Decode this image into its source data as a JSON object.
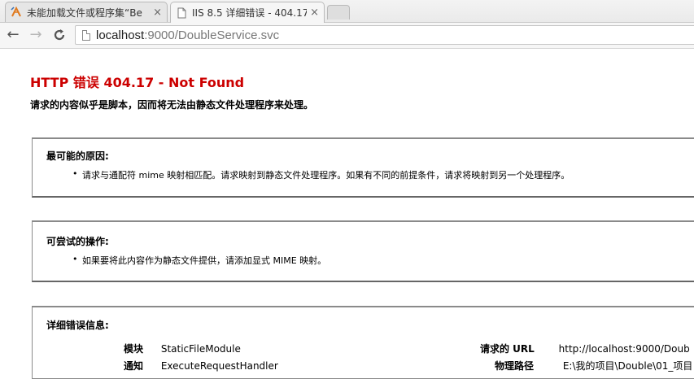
{
  "tabs": [
    {
      "title": "未能加载文件或程序集“Be",
      "active": false,
      "icon": "ie-broken-icon"
    },
    {
      "title": "IIS 8.5 详细错误 - 404.17",
      "active": true,
      "icon": "page-icon"
    }
  ],
  "toolbar": {
    "url_host": "localhost",
    "url_rest": ":9000/DoubleService.svc"
  },
  "error": {
    "title": "HTTP 错误 404.17 - Not Found",
    "subtitle": "请求的内容似乎是脚本，因而将无法由静态文件处理程序来处理。"
  },
  "causes": {
    "heading": "最可能的原因:",
    "items": [
      "请求与通配符 mime 映射相匹配。请求映射到静态文件处理程序。如果有不同的前提条件，请求将映射到另一个处理程序。"
    ]
  },
  "actions": {
    "heading": "可尝试的操作:",
    "items": [
      "如果要将此内容作为静态文件提供，请添加显式 MIME 映射。"
    ]
  },
  "details": {
    "heading": "详细错误信息:",
    "rows": [
      {
        "key": "模块",
        "value": "StaticFileModule"
      },
      {
        "key": "通知",
        "value": "ExecuteRequestHandler"
      }
    ],
    "rows_right": [
      {
        "key": "请求的 URL",
        "value": "http://localhost:9000/Doub"
      },
      {
        "key": "物理路径",
        "value": "E:\\我的项目\\Double\\01_项目"
      }
    ]
  },
  "colors": {
    "error_title": "#cc0000"
  }
}
